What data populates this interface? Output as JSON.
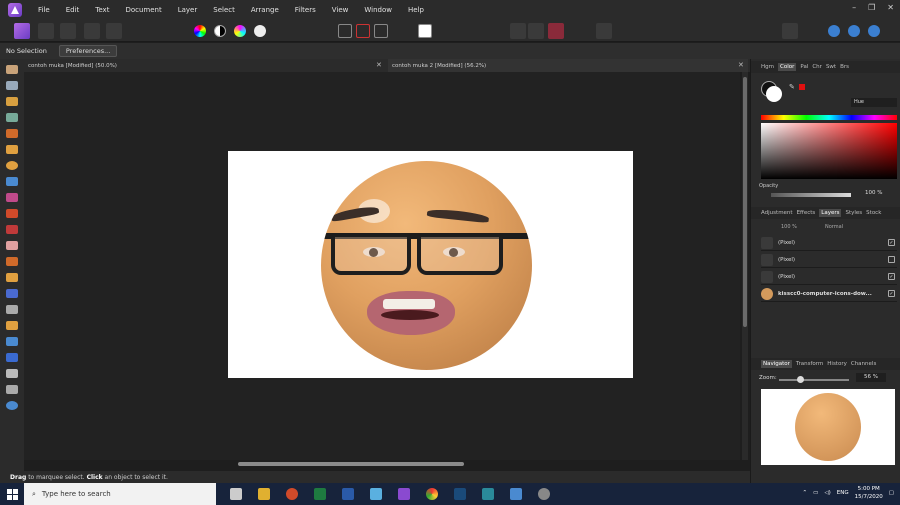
{
  "menu": {
    "items": [
      "File",
      "Edit",
      "Text",
      "Document",
      "Layer",
      "Select",
      "Arrange",
      "Filters",
      "View",
      "Window",
      "Help"
    ]
  },
  "context": {
    "selection": "No Selection",
    "preferences": "Preferences..."
  },
  "tabs": [
    {
      "label": "contoh muka [Modified] (50.0%)"
    },
    {
      "label": "contoh muka 2 [Modified] (56.2%)"
    }
  ],
  "status": {
    "bold1": "Drag",
    "text1": " to marquee select. ",
    "bold2": "Click",
    "text2": " an object to select it."
  },
  "color_panel": {
    "tabs": [
      "Hgm",
      "Color",
      "Pal",
      "Chr",
      "Swt",
      "Brs"
    ],
    "active": "Color",
    "mode": "Hue",
    "opacity_label": "Opacity",
    "opacity_value": "100 %",
    "fill_color": "#000000",
    "stroke_color": "#ffffff",
    "current_color": "#e01010"
  },
  "layers_panel": {
    "tabs": [
      "Adjustment",
      "Effects",
      "Layers",
      "Styles",
      "Stock"
    ],
    "active": "Layers",
    "opacity": "100 %",
    "blend": "Normal",
    "layers": [
      {
        "name": "(Pixel)"
      },
      {
        "name": "(Pixel)"
      },
      {
        "name": "(Pixel)"
      },
      {
        "name": "kisscc0-computer-icons-dow..."
      }
    ]
  },
  "navigator_panel": {
    "tabs": [
      "Navigator",
      "Transform",
      "History",
      "Channels"
    ],
    "active": "Navigator",
    "zoom_label": "Zoom:",
    "zoom_value": "56 %",
    "zoom_fraction": 0.3
  },
  "taskbar": {
    "search_placeholder": "Type here to search",
    "lang": "ENG",
    "time": "5:00 PM",
    "date": "15/7/2020"
  }
}
